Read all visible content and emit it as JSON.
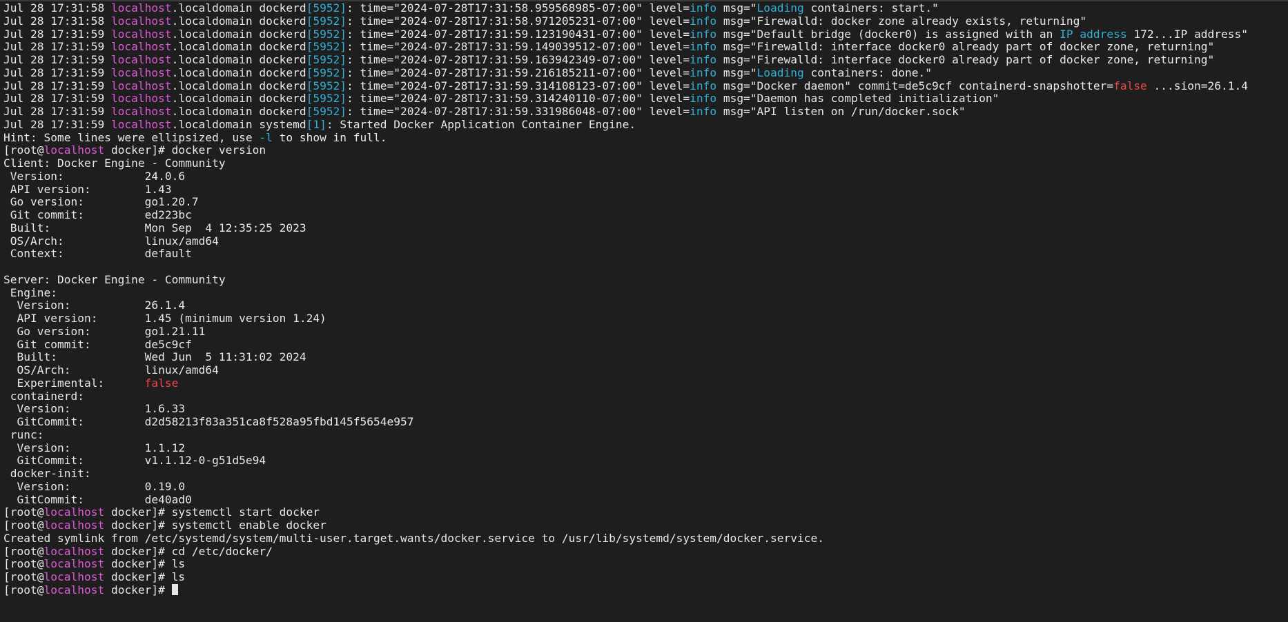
{
  "terminal": {
    "log_lines": [
      {
        "date": "Jul 28 17:31:58",
        "host": "localhost",
        "domain": ".localdomain",
        "proc": "dockerd",
        "pid": "[5952]",
        "time": "time=\"2024-07-28T17:31:58.959568985-07:00\"",
        "level_key": "level=",
        "level": "info",
        "msg_pre": "msg=\"",
        "msg_hi": "Loading",
        "msg_rest": " containers: start.\""
      },
      {
        "date": "Jul 28 17:31:58",
        "host": "localhost",
        "domain": ".localdomain",
        "proc": "dockerd",
        "pid": "[5952]",
        "time": "time=\"2024-07-28T17:31:58.971205231-07:00\"",
        "level_key": "level=",
        "level": "info",
        "msg_pre": "msg=\"Firewalld: docker zone already exists, returning\"",
        "msg_hi": "",
        "msg_rest": ""
      },
      {
        "date": "Jul 28 17:31:59",
        "host": "localhost",
        "domain": ".localdomain",
        "proc": "dockerd",
        "pid": "[5952]",
        "time": "time=\"2024-07-28T17:31:59.123190431-07:00\"",
        "level_key": "level=",
        "level": "info",
        "msg_pre": "msg=\"Default bridge (docker0) is assigned with an ",
        "msg_hi": "IP address",
        "msg_rest": " 172...IP address\""
      },
      {
        "date": "Jul 28 17:31:59",
        "host": "localhost",
        "domain": ".localdomain",
        "proc": "dockerd",
        "pid": "[5952]",
        "time": "time=\"2024-07-28T17:31:59.149039512-07:00\"",
        "level_key": "level=",
        "level": "info",
        "msg_pre": "msg=\"Firewalld: interface docker0 already part of docker zone, returning\"",
        "msg_hi": "",
        "msg_rest": ""
      },
      {
        "date": "Jul 28 17:31:59",
        "host": "localhost",
        "domain": ".localdomain",
        "proc": "dockerd",
        "pid": "[5952]",
        "time": "time=\"2024-07-28T17:31:59.163942349-07:00\"",
        "level_key": "level=",
        "level": "info",
        "msg_pre": "msg=\"Firewalld: interface docker0 already part of docker zone, returning\"",
        "msg_hi": "",
        "msg_rest": ""
      },
      {
        "date": "Jul 28 17:31:59",
        "host": "localhost",
        "domain": ".localdomain",
        "proc": "dockerd",
        "pid": "[5952]",
        "time": "time=\"2024-07-28T17:31:59.216185211-07:00\"",
        "level_key": "level=",
        "level": "info",
        "msg_pre": "msg=\"",
        "msg_hi": "Loading",
        "msg_rest": " containers: done.\""
      },
      {
        "date": "Jul 28 17:31:59",
        "host": "localhost",
        "domain": ".localdomain",
        "proc": "dockerd",
        "pid": "[5952]",
        "time": "time=\"2024-07-28T17:31:59.314108123-07:00\"",
        "level_key": "level=",
        "level": "info",
        "msg_pre": "msg=\"Docker daemon\" commit=de5c9cf containerd-snapshotter=",
        "msg_hi": "",
        "msg_red": "false",
        "msg_rest": " ...sion=26.1.4"
      },
      {
        "date": "Jul 28 17:31:59",
        "host": "localhost",
        "domain": ".localdomain",
        "proc": "dockerd",
        "pid": "[5952]",
        "time": "time=\"2024-07-28T17:31:59.314240110-07:00\"",
        "level_key": "level=",
        "level": "info",
        "msg_pre": "msg=\"Daemon has completed initialization\"",
        "msg_hi": "",
        "msg_rest": ""
      },
      {
        "date": "Jul 28 17:31:59",
        "host": "localhost",
        "domain": ".localdomain",
        "proc": "dockerd",
        "pid": "[5952]",
        "time": "time=\"2024-07-28T17:31:59.331986048-07:00\"",
        "level_key": "level=",
        "level": "info",
        "msg_pre": "msg=\"API listen on /run/docker.sock\"",
        "msg_hi": "",
        "msg_rest": ""
      }
    ],
    "systemd_line": {
      "date": "Jul 28 17:31:59",
      "host": "localhost",
      "domain": ".localdomain",
      "proc": "systemd",
      "pid": "[1]",
      "rest": ": Started Docker Application Container Engine."
    },
    "hint": {
      "pre": "Hint: Some lines were ellipsized, use ",
      "flag": "-l",
      "post": " to show in full."
    },
    "prompt": {
      "open": "[root@",
      "host": "localhost",
      "close": " docker]# "
    },
    "commands": {
      "docker_version": "docker version",
      "start": "systemctl start docker",
      "enable": "systemctl enable docker",
      "cd": "cd /etc/docker/",
      "ls1": "ls",
      "ls2": "ls"
    },
    "client_header": "Client: Docker Engine - Community",
    "client": [
      {
        "key": " Version:",
        "value": "24.0.6"
      },
      {
        "key": " API version:",
        "value": "1.43"
      },
      {
        "key": " Go version:",
        "value": "go1.20.7"
      },
      {
        "key": " Git commit:",
        "value": "ed223bc"
      },
      {
        "key": " Built:",
        "value": "Mon Sep  4 12:35:25 2023"
      },
      {
        "key": " OS/Arch:",
        "value": "linux/amd64"
      },
      {
        "key": " Context:",
        "value": "default"
      }
    ],
    "server_header": "Server: Docker Engine - Community",
    "engine_header": " Engine:",
    "engine": [
      {
        "key": "  Version:",
        "value": "26.1.4"
      },
      {
        "key": "  API version:",
        "value": "1.45 (minimum version 1.24)"
      },
      {
        "key": "  Go version:",
        "value": "go1.21.11"
      },
      {
        "key": "  Git commit:",
        "value": "de5c9cf"
      },
      {
        "key": "  Built:",
        "value": "Wed Jun  5 11:31:02 2024"
      },
      {
        "key": "  OS/Arch:",
        "value": "linux/amd64"
      },
      {
        "key": "  Experimental:",
        "value": "false",
        "red": true
      }
    ],
    "containerd_header": " containerd:",
    "containerd": [
      {
        "key": "  Version:",
        "value": "1.6.33"
      },
      {
        "key": "  GitCommit:",
        "value": "d2d58213f83a351ca8f528a95fbd145f5654e957"
      }
    ],
    "runc_header": " runc:",
    "runc": [
      {
        "key": "  Version:",
        "value": "1.1.12"
      },
      {
        "key": "  GitCommit:",
        "value": "v1.1.12-0-g51d5e94"
      }
    ],
    "dockerinit_header": " docker-init:",
    "dockerinit": [
      {
        "key": "  Version:",
        "value": "0.19.0"
      },
      {
        "key": "  GitCommit:",
        "value": "de40ad0"
      }
    ],
    "symlink_output": "Created symlink from /etc/systemd/system/multi-user.target.wants/docker.service to /usr/lib/systemd/system/docker.service."
  }
}
